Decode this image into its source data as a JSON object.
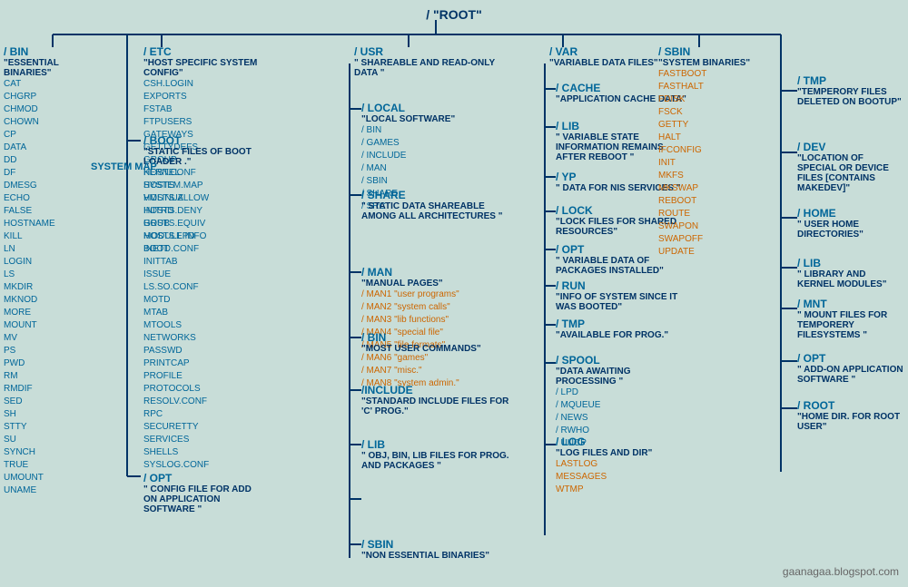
{
  "root": {
    "label": "/   \"ROOT\""
  },
  "watermark": "gaanagaa.blogspot.com",
  "sections": {
    "bin": {
      "title": "/ BIN",
      "desc": "\"ESSENTIAL BINARIES\"",
      "files": [
        "CAT",
        "CHGRP",
        "CHMOD",
        "CHOWN",
        "CP",
        "DATA",
        "DD",
        "DF",
        "DMESG",
        "ECHO",
        "FALSE",
        "HOSTNAME",
        "KILL",
        "LN",
        "LOGIN",
        "LS",
        "MKDIR",
        "MKNOD",
        "MORE",
        "MOUNT",
        "MV",
        "PS",
        "PWD",
        "RM",
        "RMDIF",
        "SED",
        "SH",
        "STTY",
        "SU",
        "SYNCH",
        "TRUE",
        "UMOUNT",
        "UNAME"
      ]
    },
    "boot": {
      "title": "/ BOOT",
      "desc": "\"STATIC FILES OF BOOT LOADER .\"",
      "files": [
        "KERNEL",
        "SYSTEM.MAP",
        "VMLINUZ",
        "INITRD",
        "GRUB",
        "MODULE.INFO",
        "BOOT"
      ]
    },
    "etc": {
      "title": "/ ETC",
      "desc": "\"HOST SPECIFIC SYSTEM CONFIG\"",
      "files": [
        "CSH.LOGIN",
        "EXPORTS",
        "FSTAB",
        "FTPUSERS",
        "GATEWAYS",
        "GETTYDEFS",
        "GROUP",
        "HOST.CONF",
        "HOSTS",
        "HOSTS.ALLOW",
        "HOSTS.DENY",
        "HOSTS.EQUIV",
        "HOSTS.LPD",
        "INETD.CONF",
        "INITTAB",
        "ISSUE",
        "LS.SO.CONF",
        "MOTD",
        "MTAB",
        "MTOOLS",
        "NETWORKS",
        "PASSWD",
        "PRINTCAP",
        "PROFILE",
        "PROTOCOLS",
        "RESOLV.CONF",
        "RPC",
        "SECURETTY",
        "SERVICES",
        "SHELLS",
        "SYSLOG.CONF"
      ]
    },
    "etc_opt": {
      "title": "/ OPT",
      "desc": "\" CONFIG FILE FOR ADD ON APPLICATION SOFTWARE \""
    },
    "usr": {
      "title": "/ USR",
      "desc": "\" SHAREABLE AND READ-ONLY DATA \"",
      "subsections": {
        "local": {
          "title": "/ LOCAL",
          "desc": "\"LOCAL SOFTWARE\"",
          "items": [
            "/ BIN",
            "/ GAMES",
            "/ INCLUDE",
            "/ MAN",
            "/ SBIN",
            "/ SHARE",
            "/ SRC"
          ]
        },
        "share": {
          "title": "/ SHARE",
          "desc": "\" STATIC DATA SHAREABLE AMONG ALL ARCHITECTURES \""
        },
        "man": {
          "title": "/ MAN",
          "desc": "\"MANUAL PAGES\"",
          "items": [
            "/ MAN1 \"user programs\"",
            "/ MAN2 \"system calls\"",
            "/ MAN3 \"lib functions\"",
            "/ MAN4 \"special file\"",
            "/ MAN5 \"file formats\"",
            "/ MAN6 \"games\"",
            "/ MAN7 \"misc.\"",
            "/ MAN8 \"system admin.\""
          ]
        },
        "bin": {
          "title": "/ BIN",
          "desc": "\"MOST USER COMMANDS\""
        },
        "include": {
          "title": "/INCLUDE",
          "desc": "\"STANDARD INCLUDE FILES FOR 'C' PROG.\""
        },
        "lib": {
          "title": "/ LIB",
          "desc": "\" OBJ, BIN, LIB FILES FOR PROG. AND PACKAGES \""
        },
        "sbin": {
          "title": "/ SBIN",
          "desc": "\"NON ESSENTIAL BINARIES\""
        }
      }
    },
    "var": {
      "title": "/ VAR",
      "desc": "\"VARIABLE DATA FILES\"",
      "subsections": {
        "cache": {
          "title": "/ CACHE",
          "desc": "\"APPLICATION CACHE DATA\""
        },
        "lib": {
          "title": "/ LIB",
          "desc": "\" VARIABLE STATE INFORMATION REMAINS AFTER REBOOT \""
        },
        "yp": {
          "title": "/ YP",
          "desc": "\" DATA FOR NIS SERVICES \""
        },
        "lock": {
          "title": "/ LOCK",
          "desc": "\"LOCK FILES FOR SHARED RESOURCES\""
        },
        "opt": {
          "title": "/ OPT",
          "desc": "\" VARIABLE DATA OF PACKAGES INSTALLED\""
        },
        "run": {
          "title": "/ RUN",
          "desc": "\"INFO OF SYSTEM SINCE IT WAS BOOTED\""
        },
        "tmp": {
          "title": "/ TMP",
          "desc": "\"AVAILABLE FOR PROG.\""
        },
        "spool": {
          "title": "/ SPOOL",
          "desc": "\"DATA AWAITING PROCESSING \"",
          "items": [
            "/ LPD",
            "/ MQUEUE",
            "/ NEWS",
            "/ RWHO",
            "/ UUCP"
          ]
        },
        "log": {
          "title": "/ LOG",
          "desc": "\"LOG FILES AND DIR\"",
          "items_highlight": [
            "LASTLOG",
            "MESSAGES",
            "WTMP"
          ]
        }
      }
    },
    "sbin": {
      "title": "/ SBIN",
      "desc": "\"SYSTEM BINARIES\"",
      "files_highlight": [
        "FASTBOOT",
        "FASTHALT",
        "FDISK",
        "FSCK",
        "GETTY",
        "HALT",
        "IFCONFIG",
        "INIT",
        "MKFS",
        "MKSWAP",
        "REBOOT",
        "ROUTE",
        "SWAPON",
        "SWAPOFF",
        "UPDATE"
      ]
    },
    "tmp": {
      "title": "/ TMP",
      "desc": "\"TEMPERORY FILES DELETED ON BOOTUP\""
    },
    "dev": {
      "title": "/ DEV",
      "desc": "\"LOCATION OF SPECIAL OR DEVICE FILES [CONTAINS MAKEDEV]\""
    },
    "home": {
      "title": "/ HOME",
      "desc": "\" USER HOME DIRECTORIES\""
    },
    "lib": {
      "title": "/ LIB",
      "desc": "\"  LIBRARY AND KERNEL MODULES\""
    },
    "mnt": {
      "title": "/ MNT",
      "desc": "\"  MOUNT FILES FOR TEMPORERY FILESYSTEMS \""
    },
    "opt": {
      "title": "/ OPT",
      "desc": "\" ADD-ON APPLICATION SOFTWARE \""
    },
    "root_dir": {
      "title": "/ ROOT",
      "desc": "\"HOME DIR. FOR ROOT USER\""
    }
  }
}
